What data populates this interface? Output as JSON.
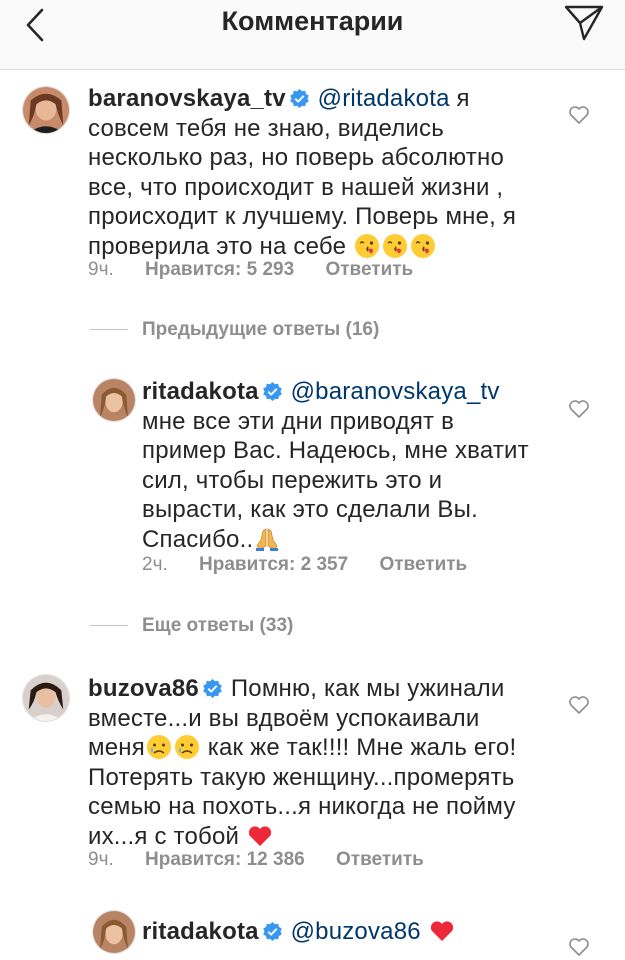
{
  "header": {
    "title": "Комментарии",
    "back_icon": "chevron-left-icon",
    "send_icon": "paper-plane-icon"
  },
  "comments": [
    {
      "username": "baranovskaya_tv",
      "mention": "@ritadakota",
      "text_lines": [
        " я",
        "совсем тебя не знаю, виделись",
        "несколько раз, но поверь абсолютно",
        "все, что происходит в нашей жизни ,",
        "происходит к лучшему. Поверь мне, я",
        "проверила это на себе"
      ],
      "time": "9ч.",
      "likes": "Нравится: 5 293",
      "reply": "Ответить"
    },
    {
      "username": "ritadakota",
      "mention": "@baranovskaya_tv",
      "text_lines": [
        "мне все эти дни приводят в",
        "пример Вас. Надеюсь, мне хватит",
        "сил, чтобы пережить это и",
        "вырасти, как это сделали Вы.",
        "Спасибо.."
      ],
      "time": "2ч.",
      "likes": "Нравится: 2 357",
      "reply": "Ответить"
    },
    {
      "username": "buzova86",
      "text_lines": [
        " Помню, как мы ужинали",
        "вместе...и вы вдвоём успокаивали",
        "меня",
        " как же так!!!! Мне жаль его!",
        "Потерять такую женщину...промерять",
        "семью на похоть...я никогда не пойму",
        "их...я с тобой"
      ],
      "time": "9ч.",
      "likes": "Нравится: 12 386",
      "reply": "Ответить"
    },
    {
      "username": "ritadakota",
      "mention": "@buzova86"
    }
  ],
  "replies_toggles": [
    {
      "label": "Предыдущие ответы (16)"
    },
    {
      "label": "Еще ответы (33)"
    }
  ],
  "colors": {
    "verified": "#3897f0",
    "mention": "#00376b",
    "meta": "#8e8e8e",
    "heart_red": "#ed2939"
  }
}
